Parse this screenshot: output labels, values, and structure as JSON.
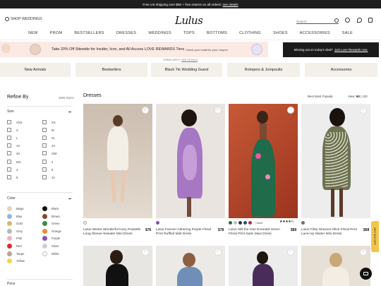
{
  "promo": {
    "text": "Free US shipping over $50 + free returns on all orders!",
    "link": "see details"
  },
  "header": {
    "shop_weddings": "SHOP WEDDINGS",
    "logo": "Lulus",
    "search_placeholder": "Search"
  },
  "nav": [
    "NEW",
    "PROM",
    "BESTSELLERS",
    "DRESSES",
    "WEDDINGS",
    "TOPS",
    "BOTTOMS",
    "CLOTHING",
    "SHOES",
    "ACCESSORIES",
    "SALE"
  ],
  "rewards": {
    "text": "Take 20% Off Sitewide for Insider, Icon, and All Access LOVE REWARDS Tiers",
    "sub": "Check your email for your coupon",
    "dark": "Missing out on today's deal?",
    "dark_link": "Join Love Rewards now.",
    "terms": "TERMS APPLY.",
    "terms_link": "SEE DETAILS"
  },
  "categories": [
    "New Arrivals",
    "Bestsellers",
    "Black Tie Wedding Guest",
    "Rompers & Jumpsuits",
    "Accessories"
  ],
  "sidebar": {
    "title": "Refine By",
    "count": "3688 Styles",
    "size_head": "Size",
    "sizes_left": [
      "XXS",
      "S",
      "L",
      "1X",
      "3X",
      "M/L",
      "4",
      "8"
    ],
    "sizes_right": [
      "XS",
      "M",
      "XL",
      "2X",
      "S/M",
      "2",
      "6",
      "10"
    ],
    "color_head": "Color",
    "colors_left": [
      {
        "name": "Beige",
        "hex": "#e3d3bd"
      },
      {
        "name": "Blue",
        "hex": "#8db6e2"
      },
      {
        "name": "Gold",
        "hex": "#d8b96a"
      },
      {
        "name": "Grey",
        "hex": "#b8b8b8"
      },
      {
        "name": "Pink",
        "hex": "#f2b3c7"
      },
      {
        "name": "Red",
        "hex": "#d23030"
      },
      {
        "name": "Taupe",
        "hex": "#b9a48f"
      },
      {
        "name": "Yellow",
        "hex": "#f2d64c"
      }
    ],
    "colors_right": [
      {
        "name": "Black",
        "hex": "#111111"
      },
      {
        "name": "Brown",
        "hex": "#7a4d2b"
      },
      {
        "name": "Green",
        "hex": "#3b8a4a"
      },
      {
        "name": "Orange",
        "hex": "#ee8a30"
      },
      {
        "name": "Purple",
        "hex": "#8a4fb0"
      },
      {
        "name": "Silver",
        "hex": "#cfcfcf"
      },
      {
        "name": "White",
        "hex": "#ffffff"
      }
    ],
    "price_head": "Price"
  },
  "products_header": {
    "title": "Dresses",
    "sort": "Best Most Popular",
    "view_label": "View:",
    "view_60": "60",
    "view_120": "120"
  },
  "products": [
    {
      "name": "Lulus Winter Wonderful Ivory Pointelle Long Sleeve Sweater Mini Dress",
      "price": "$76"
    },
    {
      "name": "Lulus Forever Admiring Purple Floral Print Ruffled Midi Dress",
      "price": "$78"
    },
    {
      "name": "Lulus Still the One Emerald Green Floral Print Satin Maxi Dress",
      "price": "$89",
      "more": "+ More",
      "stars": "★★★★½"
    },
    {
      "name": "Lulus Flirty Glances Olive Floral Print Lace-Up Skater Mini Dress",
      "price": "$68"
    }
  ],
  "side_tab": "GET $15 OFF",
  "colors": {
    "accent_bar": "#1e1e1e",
    "rewards_bg": "#fbe9e4",
    "tile_bg": "#f3efe9",
    "tab": "#f1c64a"
  }
}
